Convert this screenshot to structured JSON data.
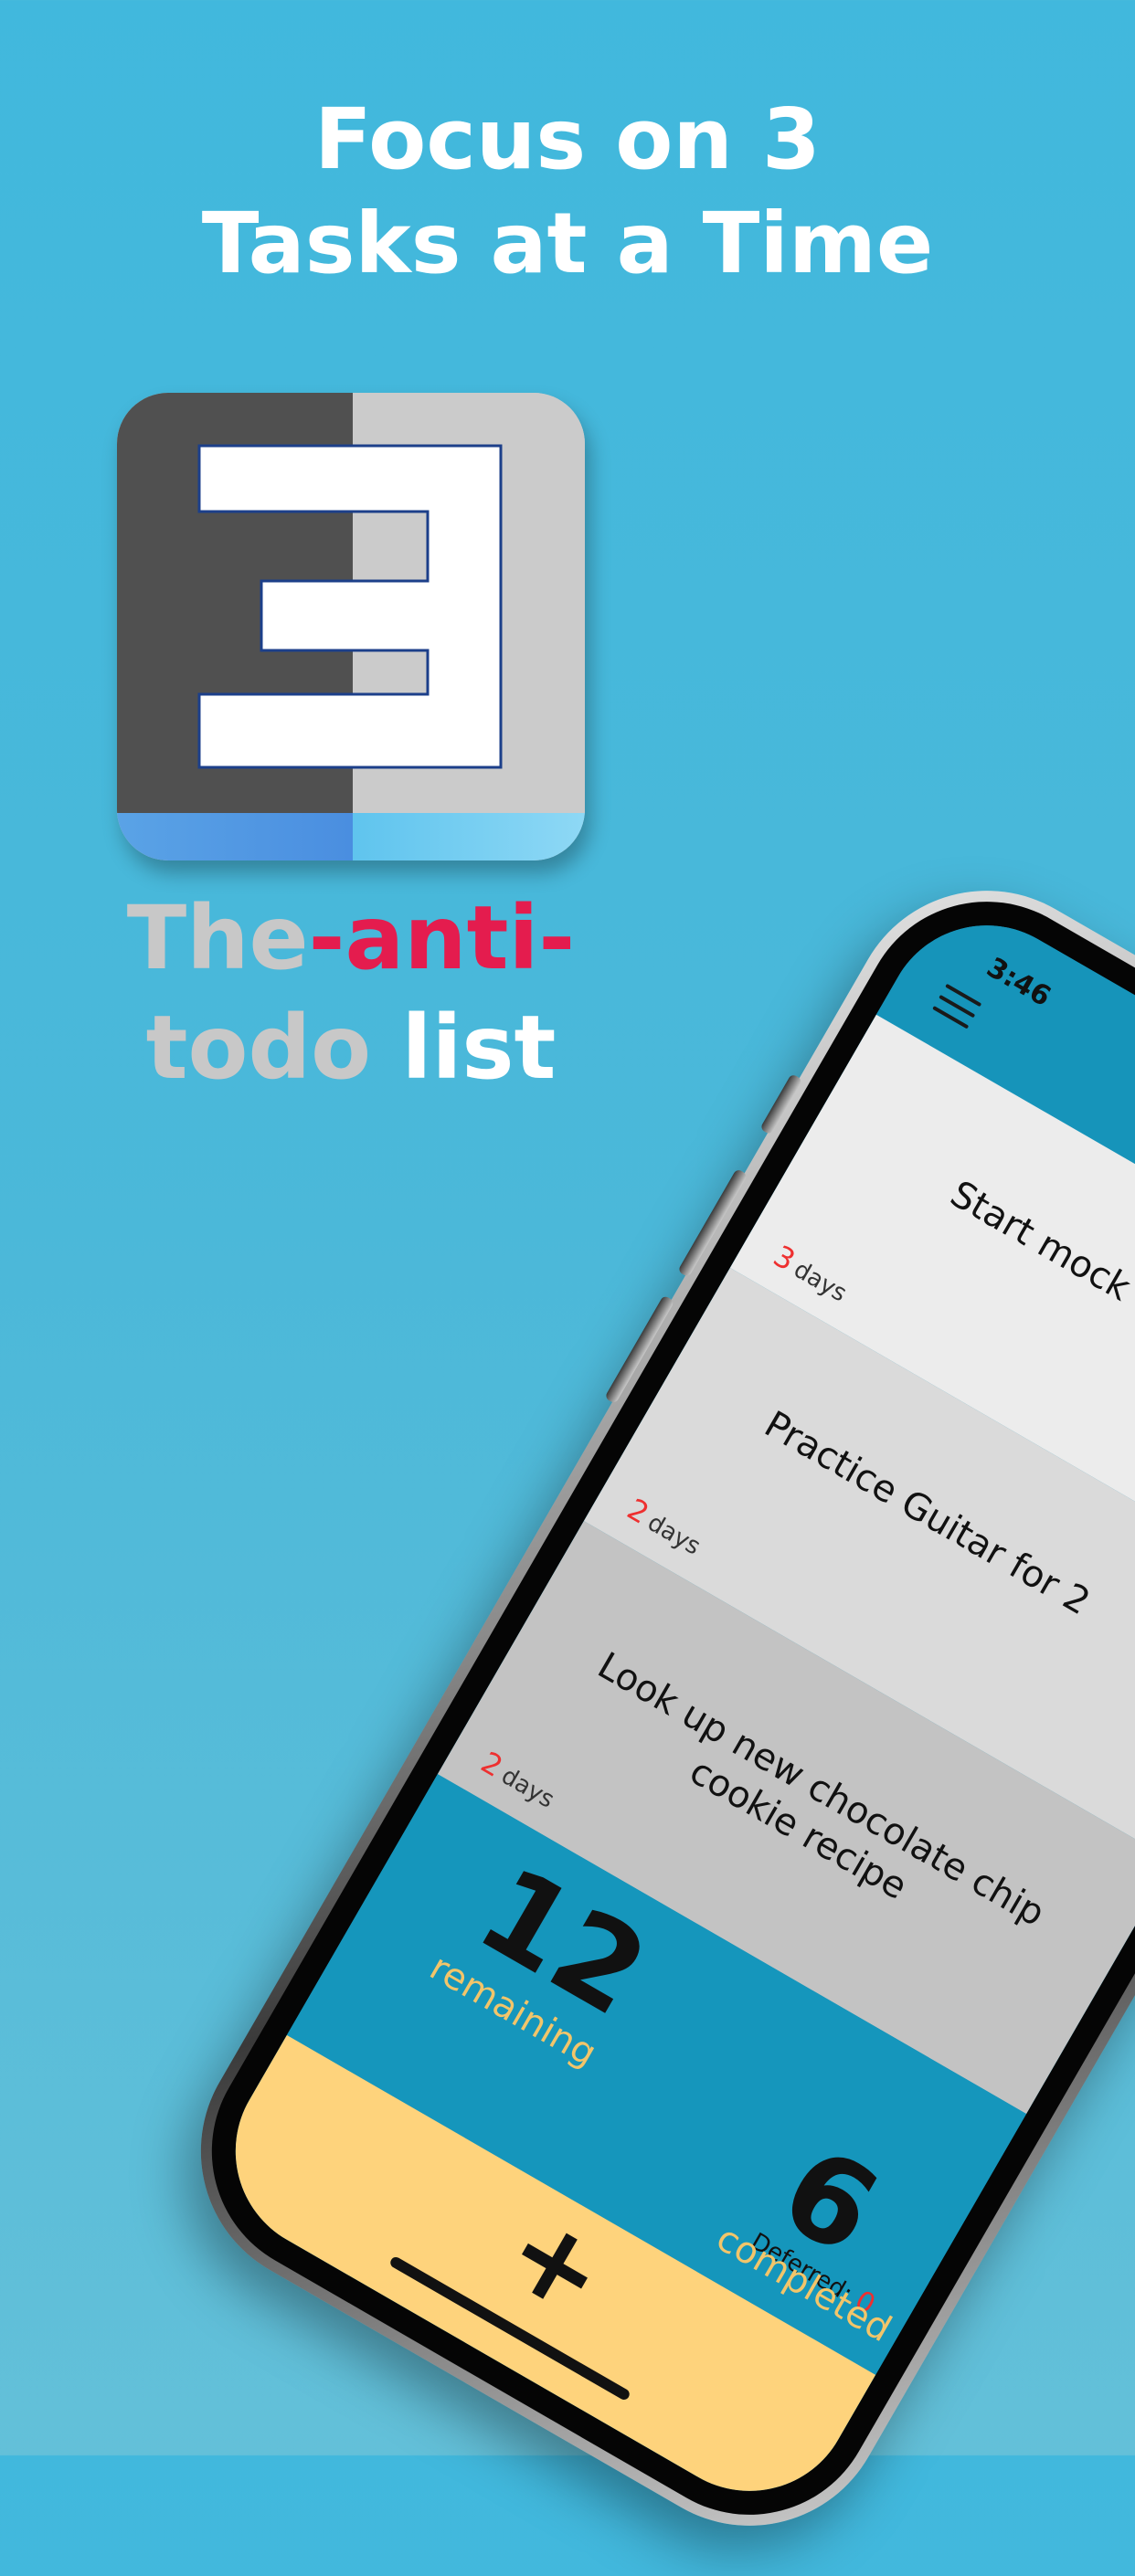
{
  "headline": {
    "line1": "Focus on 3",
    "line2": "Tasks at a Time"
  },
  "app_icon": {
    "name": "three-app-icon"
  },
  "tagline": {
    "part1": "The",
    "part2": "-anti-",
    "part3": "todo",
    "part4": "list"
  },
  "phone": {
    "status_time": "3:46",
    "tasks": [
      {
        "title": "Start mock",
        "days_num": "3",
        "days_label": "days"
      },
      {
        "title": "Practice Guitar for 2",
        "days_num": "2",
        "days_label": "days"
      },
      {
        "title": "Look up new chocolate chip cookie recipe",
        "days_num": "2",
        "days_label": "days"
      }
    ],
    "stats": {
      "remaining_num": "12",
      "remaining_label": "remaining",
      "completed_num": "6",
      "completed_label": "completed",
      "deferred_label": "Deferred:",
      "deferred_value": "0"
    },
    "add_label": "+"
  },
  "colors": {
    "background": "#41b8dd",
    "accent_red": "#e41c4e",
    "stats_blue": "#1596bc",
    "add_yellow": "#fed37c",
    "label_gold": "#f2c56a"
  }
}
